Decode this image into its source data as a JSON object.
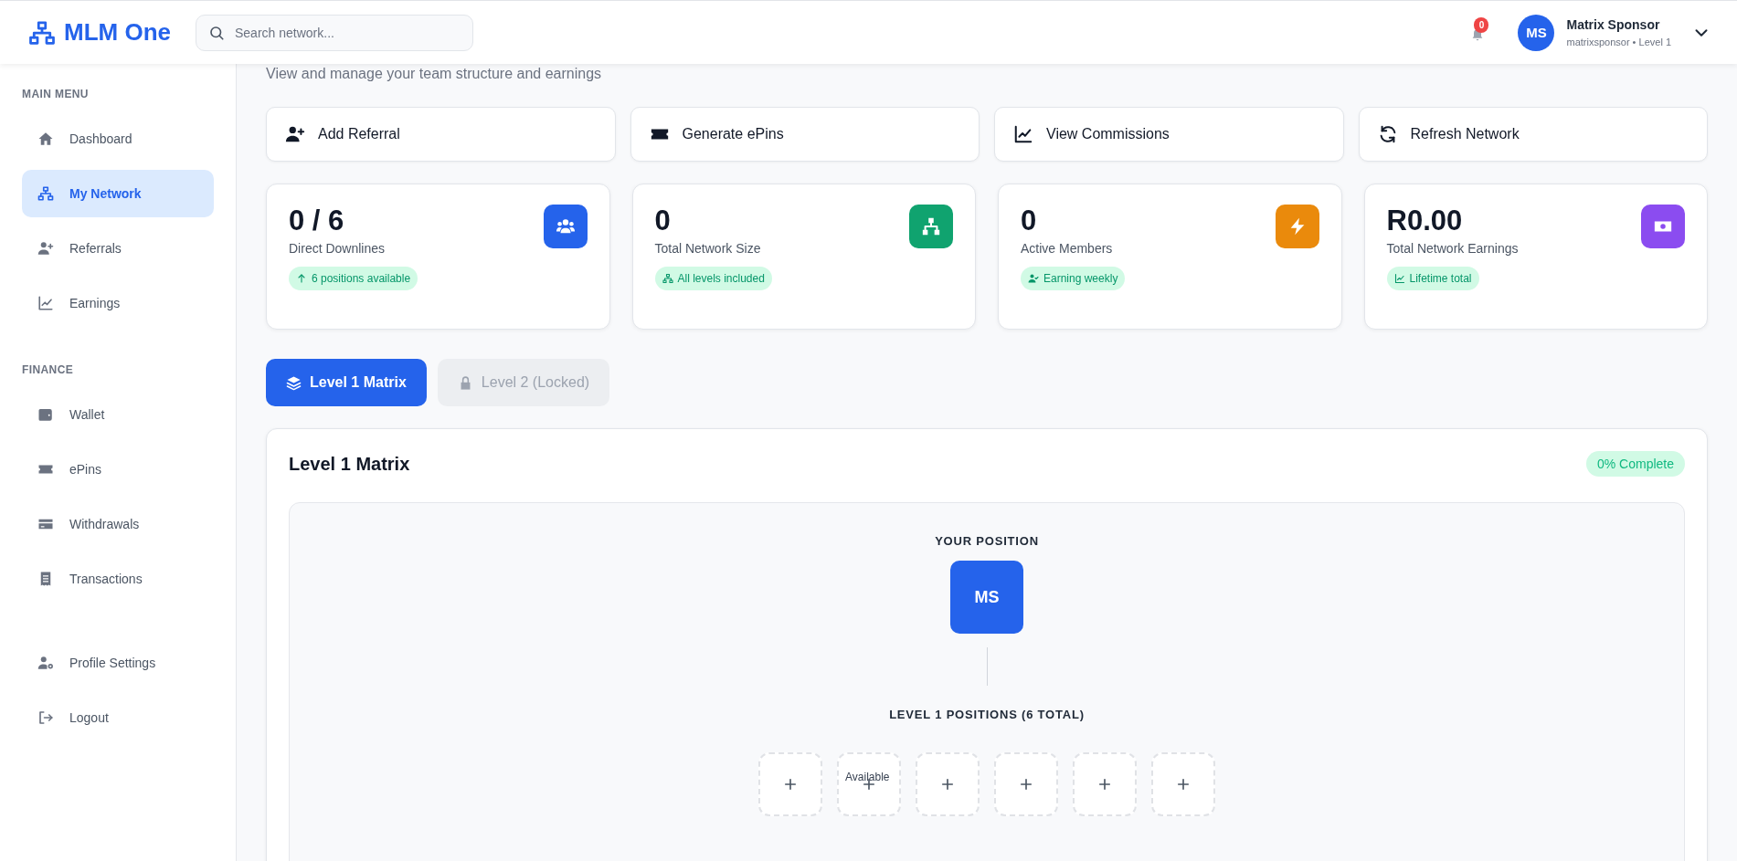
{
  "header": {
    "brand": "MLM One",
    "search": {
      "placeholder": "Search network..."
    },
    "notifications": {
      "count": "0"
    },
    "user": {
      "initials": "MS",
      "name": "Matrix Sponsor",
      "subtitle": "matrixsponsor • Level 1"
    }
  },
  "sidebar": {
    "sections": [
      {
        "title": "MAIN MENU",
        "items": [
          {
            "label": "Dashboard",
            "selected": false
          },
          {
            "label": "My Network",
            "selected": true
          },
          {
            "label": "Referrals",
            "selected": false
          },
          {
            "label": "Earnings",
            "selected": false
          }
        ]
      },
      {
        "title": "FINANCE",
        "items": [
          {
            "label": "Wallet",
            "selected": false
          },
          {
            "label": "ePins",
            "selected": false
          },
          {
            "label": "Withdrawals",
            "selected": false
          },
          {
            "label": "Transactions",
            "selected": false
          }
        ]
      },
      {
        "items": [
          {
            "label": "Profile Settings",
            "selected": false
          },
          {
            "label": "Logout",
            "selected": false
          }
        ]
      }
    ]
  },
  "page": {
    "subtitle": "View and manage your team structure and earnings"
  },
  "actions": [
    {
      "label": "Add Referral"
    },
    {
      "label": "Generate ePins"
    },
    {
      "label": "View Commissions"
    },
    {
      "label": "Refresh Network"
    }
  ],
  "stats": [
    {
      "value": "0 / 6",
      "label": "Direct Downlines",
      "color": "#2563eb",
      "badge": "6 positions available"
    },
    {
      "value": "0",
      "label": "Total Network Size",
      "color": "#10a36f",
      "badge": "All levels included"
    },
    {
      "value": "0",
      "label": "Active Members",
      "color": "#ea8a0c",
      "badge": "Earning weekly"
    },
    {
      "value": "R0.00",
      "label": "Total Network Earnings",
      "color": "#8b4cf0",
      "badge": "Lifetime total"
    }
  ],
  "tabs": [
    {
      "label": "Level 1 Matrix",
      "selected": true,
      "locked": false
    },
    {
      "label": "Level 2 (Locked)",
      "selected": false,
      "locked": true
    }
  ],
  "matrix": {
    "title": "Level 1 Matrix",
    "progress": "0% Complete",
    "root_label": "YOUR POSITION",
    "root": "MS",
    "level_label": "LEVEL 1 POSITIONS (6 TOTAL)",
    "slots": [
      {
        "kind": "empty"
      },
      {
        "kind": "empty",
        "tooltip": "Available"
      },
      {
        "kind": "empty"
      },
      {
        "kind": "empty"
      },
      {
        "kind": "empty"
      },
      {
        "kind": "empty"
      }
    ]
  }
}
